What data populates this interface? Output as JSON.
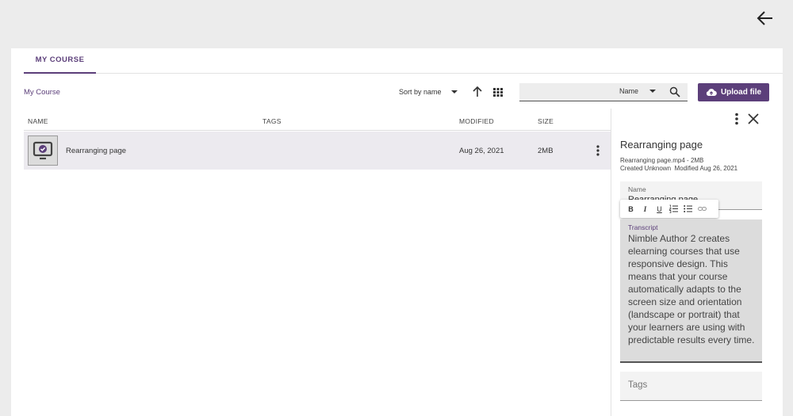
{
  "header": {
    "back_icon": "arrow-left-icon"
  },
  "tabs": [
    {
      "label": "MY COURSE",
      "active": true
    }
  ],
  "breadcrumb": "My Course",
  "toolbar": {
    "sort_label": "Sort by name",
    "sort_direction_icon": "arrow-up-icon",
    "view_icon": "grid-view-icon",
    "search_placeholder": "",
    "search_type": "Name",
    "search_icon": "search-icon",
    "upload_label": "Upload file",
    "upload_icon": "cloud-upload-icon"
  },
  "table": {
    "columns": [
      "NAME",
      "TAGS",
      "MODIFIED",
      "SIZE"
    ],
    "rows": [
      {
        "name": "Rearranging page",
        "tags": "",
        "modified": "Aug 26, 2021",
        "size": "2MB",
        "thumb_icon": "video-check-icon",
        "selected": true
      }
    ]
  },
  "details": {
    "title": "Rearranging page",
    "meta_line1": "Rearranging page.mp4 - 2MB",
    "meta_line2": "Created Unknown  Modified Aug 26, 2021",
    "name_label": "Name",
    "name_value": "Rearranging page",
    "format_buttons": [
      "B",
      "I",
      "U"
    ],
    "format_icons": [
      "bold-icon",
      "italic-icon",
      "underline-icon",
      "ordered-list-icon",
      "bullet-list-icon",
      "link-icon"
    ],
    "transcript_label": "Transcript",
    "transcript_text": "Nimble Author 2 creates elearning courses that use responsive design. This means that your course automatically adapts to the screen size and orientation (landscape or portrait) that your learners are using with predictable results every time.",
    "tags_label": "Tags"
  },
  "colors": {
    "accent": "#5c3f7a",
    "selected_row": "#eceaef",
    "background": "#ececec"
  }
}
